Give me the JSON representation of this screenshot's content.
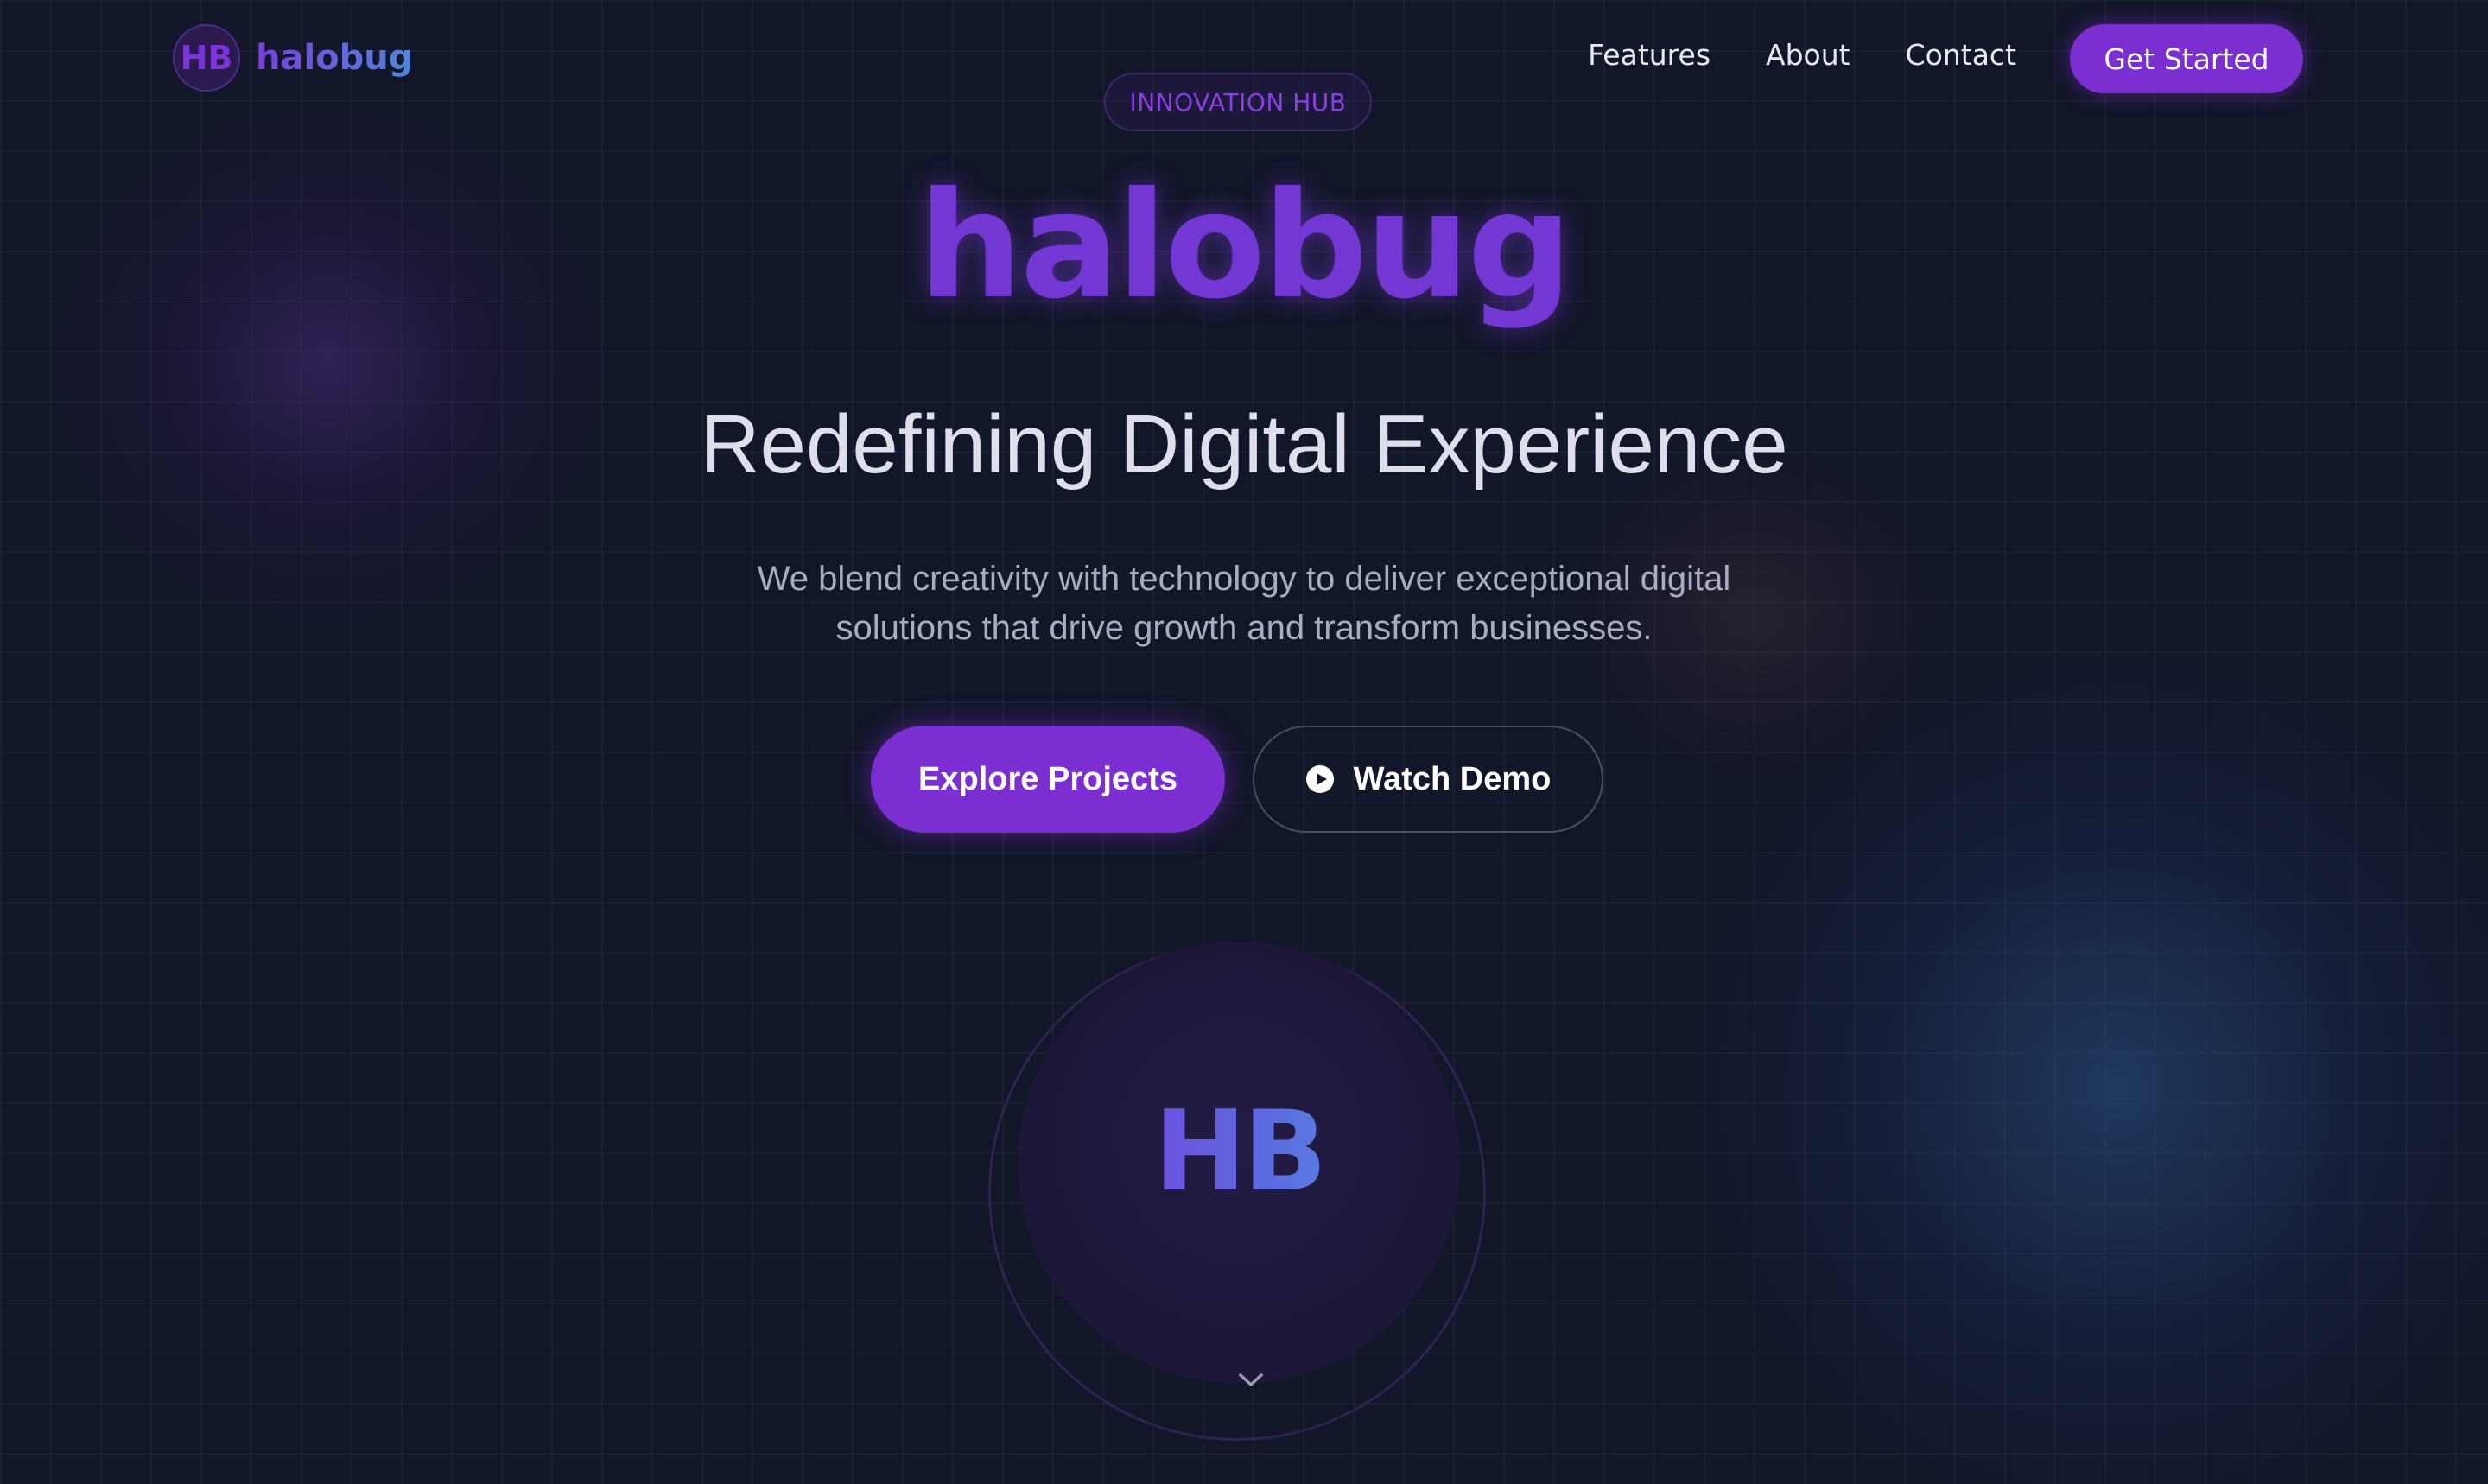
{
  "brand": {
    "badge": "HB",
    "name": "halobug"
  },
  "nav": {
    "links": [
      "Features",
      "About",
      "Contact"
    ],
    "cta_label": "Get Started"
  },
  "hero": {
    "pill": "INNOVATION HUB",
    "title": "halobug",
    "subtitle": "Redefining Digital Experience",
    "description_line1": "We blend creativity with technology to deliver exceptional digital",
    "description_line2": "solutions that drive growth and transform businesses.",
    "primary_button": "Explore Projects",
    "secondary_button": "Watch Demo",
    "orb_text": "HB"
  },
  "icons": {
    "play": "play-circle-icon",
    "scroll": "chevron-down-icon"
  },
  "colors": {
    "background": "#121629",
    "accent": "#7b2fd1",
    "accent_blue": "#4f86d9",
    "text_muted": "#a9adc2"
  }
}
